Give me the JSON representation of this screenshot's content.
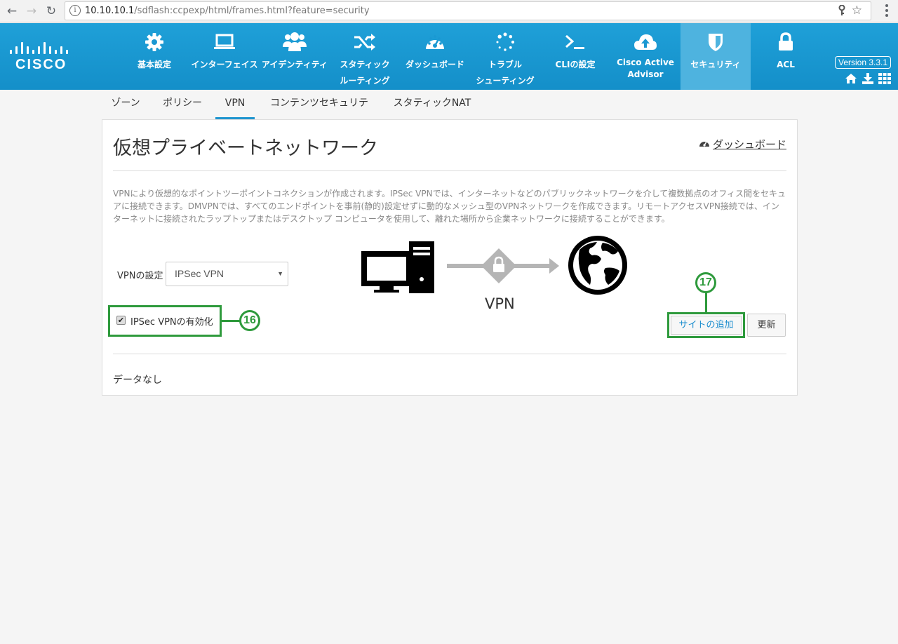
{
  "browser": {
    "url_host": "10.10.10.1",
    "url_path": "/sdflash:ccpexp/html/frames.html?feature=security"
  },
  "brand": {
    "logo_text": "CISCO"
  },
  "topnav": {
    "items": [
      {
        "label": "基本設定",
        "icon": "gear-icon"
      },
      {
        "label": "インターフェイス",
        "icon": "laptop-icon"
      },
      {
        "label": "アイデンティティ",
        "icon": "users-icon"
      },
      {
        "label_line1": "スタティック",
        "label_line2": "ルーティング",
        "icon": "shuffle-icon"
      },
      {
        "label": "ダッシュボード",
        "icon": "gauge-icon"
      },
      {
        "label_line1": "トラブル",
        "label_line2": "シューティング",
        "icon": "spinner-icon"
      },
      {
        "label": "CLIの設定",
        "icon": "terminal-icon"
      },
      {
        "label_line1": "Cisco Active",
        "label_line2": "Advisor",
        "icon": "cloud-upload-icon"
      },
      {
        "label": "セキュリティ",
        "icon": "shield-icon",
        "active": true
      },
      {
        "label": "ACL",
        "icon": "lock-icon"
      }
    ],
    "version": "Version 3.3.1"
  },
  "subtabs": [
    {
      "label": "ゾーン"
    },
    {
      "label": "ポリシー"
    },
    {
      "label": "VPN",
      "active": true
    },
    {
      "label": "コンテンツセキュリティ"
    },
    {
      "label": "スタティックNAT"
    }
  ],
  "panel": {
    "title": "仮想プライベートネットワーク",
    "dashboard_link": "ダッシュボード",
    "description": "VPNにより仮想的なポイントツーポイントコネクションが作成されます。IPSec VPNでは、インターネットなどのパブリックネットワークを介して複数拠点のオフィス間をセキュアに接続できます。DMVPNでは、すべてのエンドポイントを事前(静的)設定せずに動的なメッシュ型のVPNネットワークを作成できます。リモートアクセスVPN接続では、インターネットに接続されたラップトップまたはデスクトップ コンピュータを使用して、離れた場所から企業ネットワークに接続することができます。",
    "vpn_config_label": "VPNの設定",
    "vpn_config_value": "IPSec VPN",
    "enable_checkbox_label": "IPSec VPNの有効化",
    "enable_checked": true,
    "diagram_label": "VPN",
    "add_site_button": "サイトの追加",
    "refresh_button": "更新",
    "no_data": "データなし"
  },
  "callouts": {
    "checkbox": "16",
    "add_site": "17"
  },
  "colors": {
    "navbar": "#1a98d2",
    "active_nav": "#4eb3df",
    "callout_green": "#2e9a3c",
    "link_blue": "#1f8fcf"
  }
}
